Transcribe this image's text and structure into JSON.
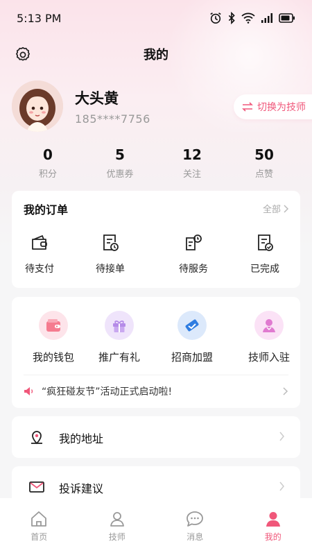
{
  "status_bar": {
    "time": "5:13 PM"
  },
  "header": {
    "title": "我的"
  },
  "profile": {
    "name": "大头黄",
    "phone": "185****7756",
    "switch_label": "切换为技师"
  },
  "stats": [
    {
      "value": "0",
      "label": "积分"
    },
    {
      "value": "5",
      "label": "优惠券"
    },
    {
      "value": "12",
      "label": "关注"
    },
    {
      "value": "50",
      "label": "点赞"
    }
  ],
  "orders": {
    "title": "我的订单",
    "more": "全部",
    "items": [
      {
        "label": "待支付",
        "icon": "wallet-icon"
      },
      {
        "label": "待接单",
        "icon": "pending-order-icon"
      },
      {
        "label": "待服务",
        "icon": "service-schedule-icon"
      },
      {
        "label": "已完成",
        "icon": "completed-order-icon"
      }
    ]
  },
  "tools": {
    "items": [
      {
        "label": "我的钱包",
        "icon": "wallet-icon",
        "color": "#f57b8f"
      },
      {
        "label": "推广有礼",
        "icon": "gift-icon",
        "color": "#b58be8"
      },
      {
        "label": "招商加盟",
        "icon": "handshake-icon",
        "color": "#2f7de1"
      },
      {
        "label": "技师入驻",
        "icon": "technician-icon",
        "color": "#e07ad0"
      }
    ],
    "notice": "“疯狂碰友节”活动正式启动啦!"
  },
  "menu": [
    {
      "label": "我的地址",
      "icon": "location-icon"
    },
    {
      "label": "投诉建议",
      "icon": "mail-icon"
    }
  ],
  "bottom_nav": [
    {
      "label": "首页",
      "icon": "home-icon"
    },
    {
      "label": "技师",
      "icon": "technician-icon"
    },
    {
      "label": "消息",
      "icon": "message-icon"
    },
    {
      "label": "我的",
      "icon": "user-icon",
      "active": true
    }
  ],
  "colors": {
    "accent": "#f0577a",
    "background": "#f6f6f7"
  }
}
